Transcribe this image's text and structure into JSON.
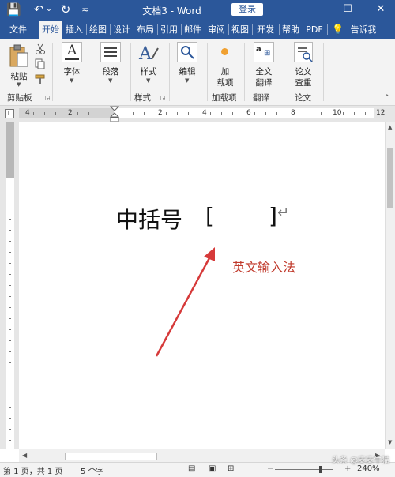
{
  "titlebar": {
    "save_icon": "💾",
    "undo_icon": "↶",
    "undo_dropdown": "⌄",
    "redo_icon": "↻",
    "customize_icon": "≂",
    "doc_title": "文档3 - Word",
    "login_label": "登录",
    "minimize_icon": "—",
    "restore_icon": "☐",
    "close_icon": "✕"
  },
  "tabs": [
    "文件",
    "开始",
    "插入",
    "绘图",
    "设计",
    "布局",
    "引用",
    "邮件",
    "审阅",
    "视图",
    "开发",
    "帮助",
    "PDF"
  ],
  "tell_me": {
    "icon": "💡",
    "label": "告诉我"
  },
  "ribbon": {
    "paste_label": "粘贴",
    "clipboard_group": "剪贴板",
    "font_label": "字体",
    "paragraph_label": "段落",
    "styles_label": "样式",
    "styles_group": "样式",
    "edit_label": "编辑",
    "addin_label_1": "加",
    "addin_label_2": "载项",
    "addin_group": "加载项",
    "translate_label_1": "全文",
    "translate_label_2": "翻译",
    "translate_group": "翻译",
    "paper_label_1": "论文",
    "paper_label_2": "查重",
    "paper_group": "论文"
  },
  "ruler_numbers": [
    "4",
    "2",
    "2",
    "4",
    "6",
    "8",
    "10",
    "12"
  ],
  "document": {
    "heading_text": "中括号",
    "bracket_open": "[",
    "bracket_close": "]",
    "paragraph_mark": "↵",
    "annotation": "英文输入法",
    "annotation_color": "#c0392b"
  },
  "statusbar": {
    "page_info": "第 1 页，共 1 页",
    "word_count": "5 个字",
    "zoom_minus": "−",
    "zoom_plus": "+",
    "zoom_level": "240%",
    "watermark": "头条 @麦麦牛猫"
  },
  "colors": {
    "brand": "#2b579a",
    "ribbon_bg": "#f3f3f3"
  }
}
